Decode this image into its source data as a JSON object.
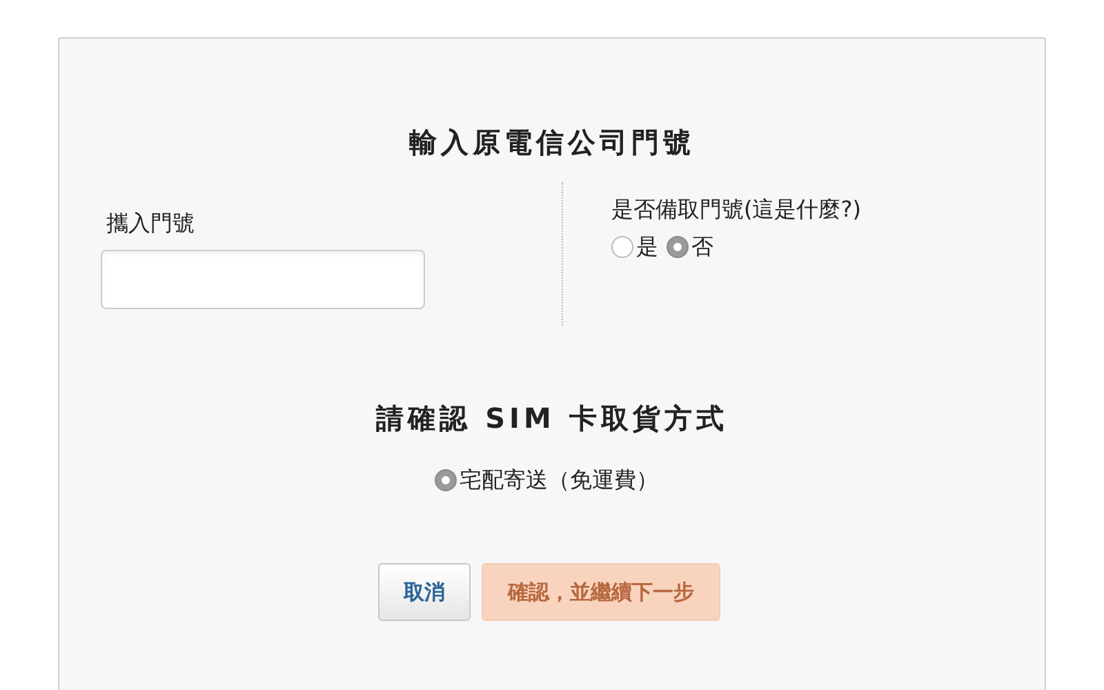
{
  "title": "輸入原電信公司門號",
  "number_field": {
    "label": "攜入門號"
  },
  "keep_number": {
    "question": "是否備取門號(這是什麼?)",
    "options": [
      {
        "label": "是",
        "selected": false
      },
      {
        "label": "否",
        "selected": true
      }
    ]
  },
  "delivery": {
    "title": "請確認 SIM 卡取貨方式",
    "options": [
      {
        "label": "宅配寄送（免運費）",
        "selected": true
      }
    ]
  },
  "buttons": [
    {
      "label": "取消",
      "kind": "secondary",
      "disabled": false
    },
    {
      "label": "確認，並繼續下一步",
      "kind": "primary",
      "disabled": true
    }
  ]
}
